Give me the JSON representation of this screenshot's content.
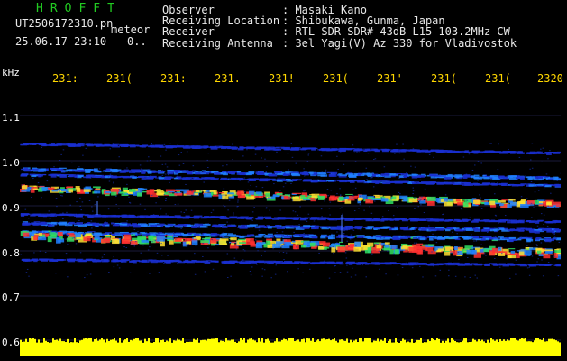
{
  "header": {
    "brand": "HROFFT",
    "filename": "UT2506172310.pn",
    "overlay": "meteor",
    "datetime": "25.06.17 23:10",
    "count": "0..",
    "info": [
      {
        "key": "Observer",
        "value": ": Masaki Kano"
      },
      {
        "key": "Receiving Location",
        "value": ": Shibukawa, Gunma, Japan"
      },
      {
        "key": "Receiver",
        "value": ": RTL-SDR SDR# 43dB L15 103.2MHz CW"
      },
      {
        "key": "Receiving Antenna",
        "value": ": 3el Yagi(V) Az 330 for Vladivostok"
      }
    ]
  },
  "axis": {
    "unit": "kHz",
    "time_ticks": [
      "231:",
      "231(",
      "231:",
      "231.",
      "231!",
      "231(",
      "231'",
      "231(",
      "231(",
      "2320"
    ],
    "freq_ticks": [
      "1.1",
      "1.0",
      "0.9",
      "0.8",
      "0.7",
      "0.6"
    ]
  },
  "colors": {
    "brand": "#22cc22",
    "tick_text": "#ffd700",
    "background": "#000000",
    "noise_floor": "#ffff00"
  }
}
